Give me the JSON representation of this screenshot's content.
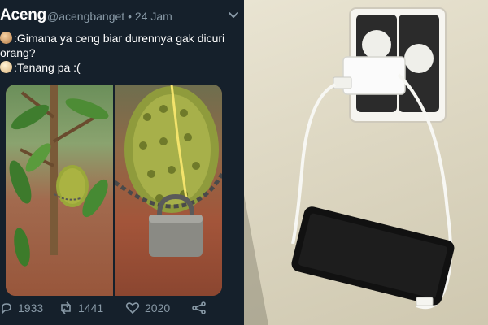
{
  "tweet": {
    "display_name": "Aceng",
    "handle_time": "@acengbanget • 24 Jam",
    "line1": ":Gimana ya ceng biar durennya gak dicuri",
    "line2": "orang?",
    "line3": ":Tenang pa :(",
    "icons": {
      "menu": "chevron-down-icon",
      "reply": "reply-icon",
      "retweet": "retweet-icon",
      "like": "heart-icon",
      "share": "share-icon"
    },
    "actions": {
      "reply_count": "1933",
      "retweet_count": "1441",
      "like_count": "2020"
    }
  },
  "colors": {
    "tweet_bg": "#15202b",
    "muted_text": "#8899a6",
    "text": "#ffffff"
  }
}
